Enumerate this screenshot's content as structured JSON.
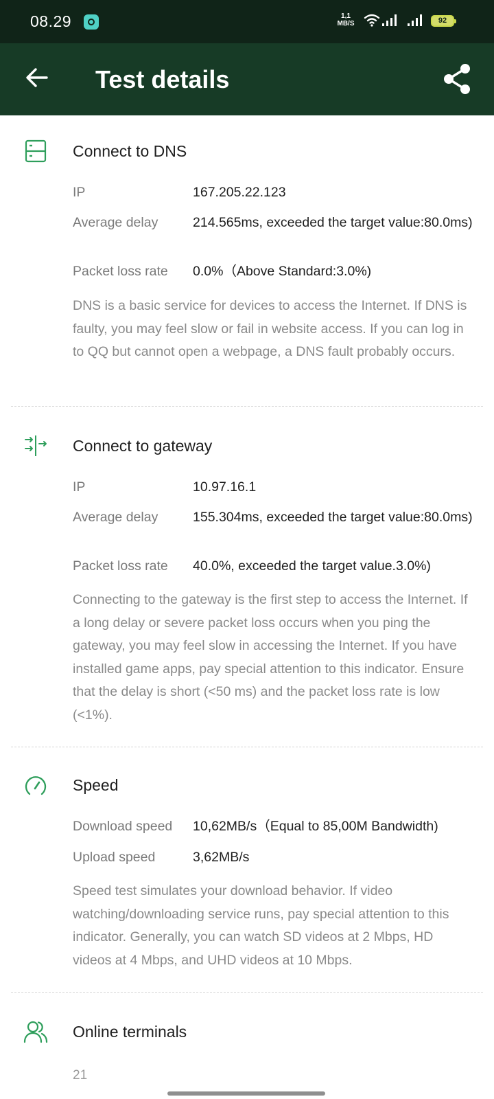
{
  "status_bar": {
    "time": "08.29",
    "net_speed_value": "1,1",
    "net_speed_unit": "MB/S",
    "battery": "92"
  },
  "app_bar": {
    "title": "Test details"
  },
  "sections": {
    "dns": {
      "title": "Connect to DNS",
      "rows": [
        {
          "label": "IP",
          "value": "167.205.22.123"
        },
        {
          "label": "Average delay",
          "value": "214.565ms, exceeded the target value:80.0ms)"
        },
        {
          "label": "Packet loss rate",
          "value": "0.0%（Above Standard:3.0%)"
        }
      ],
      "description": "DNS is a basic service for devices to access the Internet. If DNS is faulty, you may feel slow or fail in website access. If you can log in to QQ but cannot open a webpage, a DNS fault probably occurs."
    },
    "gateway": {
      "title": "Connect to gateway",
      "rows": [
        {
          "label": "IP",
          "value": "10.97.16.1"
        },
        {
          "label": "Average delay",
          "value": "155.304ms, exceeded the target value:80.0ms)"
        },
        {
          "label": "Packet loss rate",
          "value": "40.0%, exceeded the target value.3.0%)"
        }
      ],
      "description": "Connecting to the gateway is the first step to access the Internet. If a long delay or severe packet loss occurs when you ping the gateway, you may feel slow in accessing the Internet. If you have installed game apps, pay special attention to this indicator. Ensure that the delay is short (<50 ms) and the packet loss rate is low (<1%)."
    },
    "speed": {
      "title": "Speed",
      "rows": [
        {
          "label": "Download speed",
          "value": "10,62MB/s（Equal to 85,00M Bandwidth)"
        },
        {
          "label": "Upload speed",
          "value": "3,62MB/s"
        }
      ],
      "description": "Speed test simulates your download behavior. If video watching/downloading service runs, pay special attention to this indicator. Generally, you can watch SD videos at 2 Mbps, HD videos at 4 Mbps, and UHD videos at 10 Mbps."
    },
    "terminals": {
      "title": "Online terminals",
      "count": "21"
    }
  },
  "colors": {
    "status_bar_bg": "#102418",
    "app_bar_bg": "#173b26",
    "accent_green": "#2e9e5b",
    "label_gray": "#7a7a7a",
    "description_gray": "#8a8a8a"
  },
  "icons": {
    "back": "arrow-left-icon",
    "share": "share-icon",
    "dns": "server-icon",
    "gateway": "gateway-arrows-icon",
    "speed": "speedometer-icon",
    "terminals": "users-icon"
  }
}
